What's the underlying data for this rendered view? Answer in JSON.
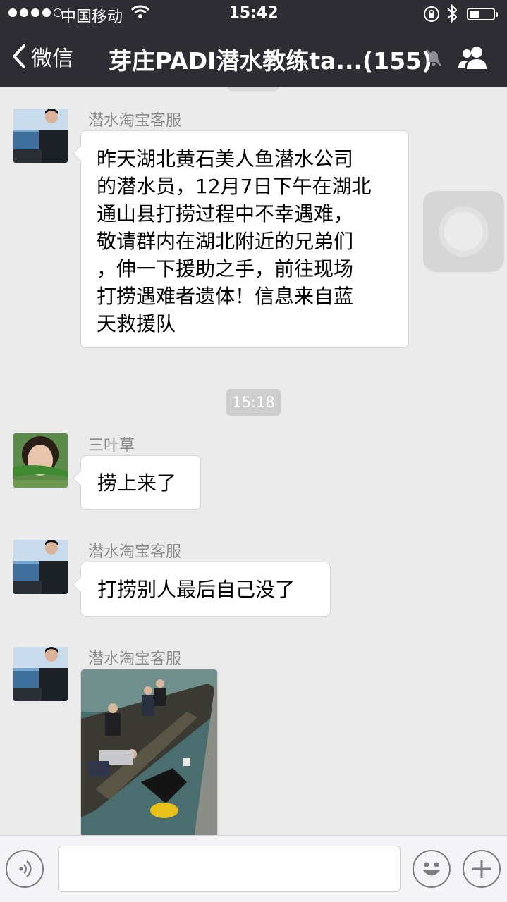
{
  "status_bar": {
    "carrier": "中国移动",
    "time": "15:42"
  },
  "nav": {
    "back_label": "微信",
    "title": "芽庄PADI潜水教练ta...(155)"
  },
  "messages": [
    {
      "sender": "潜水淘宝客服",
      "lines": [
        "昨天湖北黄石美人鱼潜水公司",
        "的潜水员，12月7日下午在湖北",
        "通山县打捞过程中不幸遇难，",
        "敬请群内在湖北附近的兄弟们",
        "，伸一下援助之手，前往现场",
        "打捞遇难者遗体！信息来自蓝",
        "天救援队"
      ]
    },
    {
      "timestamp": "15:18"
    },
    {
      "sender": "三叶草",
      "text": "捞上来了"
    },
    {
      "sender": "潜水淘宝客服",
      "text": "打捞别人最后自己没了"
    },
    {
      "sender": "潜水淘宝客服",
      "image": "rescue-boat-photo"
    }
  ],
  "icons": {
    "back": "chevron-left-icon",
    "mute": "bell-off-icon",
    "group": "group-members-icon",
    "voice": "voice-icon",
    "emoji": "emoji-icon",
    "more": "plus-icon"
  },
  "colors": {
    "nav_bg": "#2d2d33",
    "chat_bg": "#ebebeb",
    "bubble_bg": "#ffffff",
    "sender_text": "#8a8a8a"
  }
}
